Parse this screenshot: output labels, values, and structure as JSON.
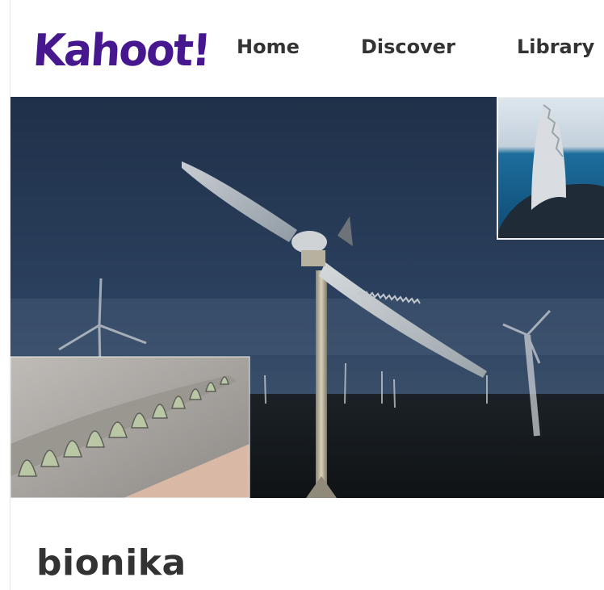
{
  "brand": {
    "logo_text": "Kahoot!",
    "color": "#46178f"
  },
  "nav": {
    "items": [
      {
        "label": "Home"
      },
      {
        "label": "Discover"
      },
      {
        "label": "Library"
      }
    ]
  },
  "hero": {
    "icon": "cover-image"
  },
  "quiz": {
    "title": "bionika"
  }
}
